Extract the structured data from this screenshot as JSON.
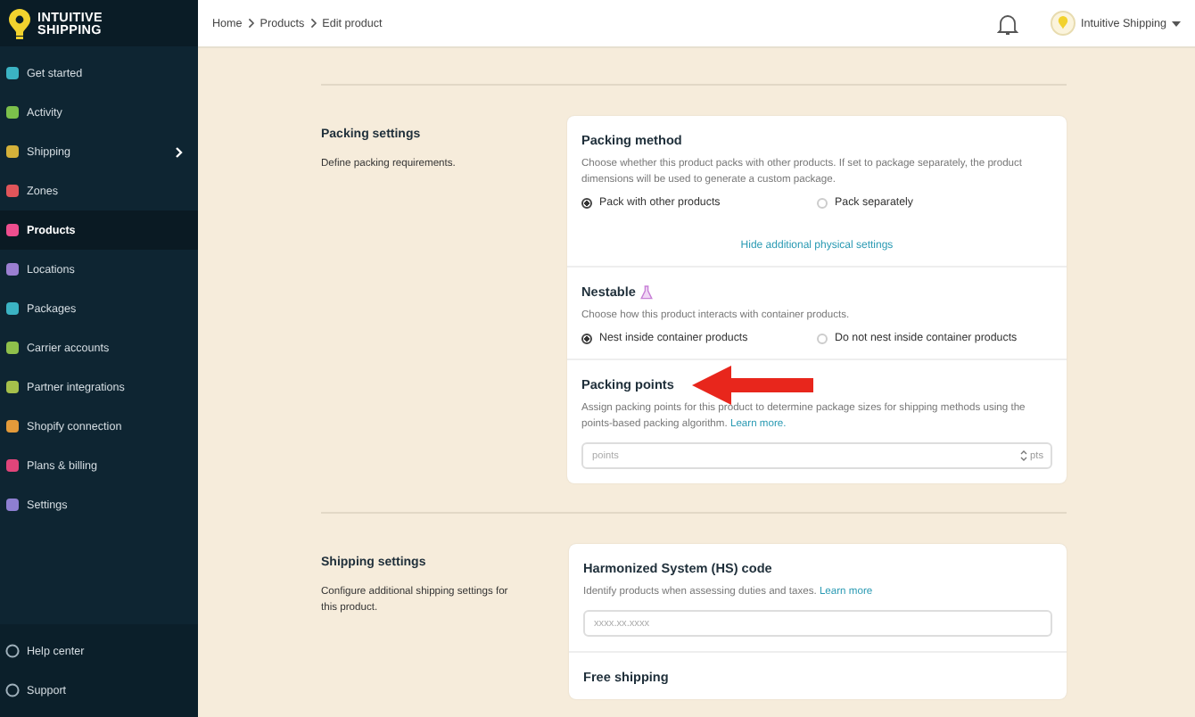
{
  "brand": {
    "line1": "INTUITIVE",
    "line2": "SHIPPING"
  },
  "sidebar": {
    "items": [
      {
        "label": "Get started",
        "selected": false,
        "expandable": false
      },
      {
        "label": "Activity",
        "selected": false,
        "expandable": false
      },
      {
        "label": "Shipping",
        "selected": false,
        "expandable": true
      },
      {
        "label": "Zones",
        "selected": false,
        "expandable": false
      },
      {
        "label": "Products",
        "selected": true,
        "expandable": false
      },
      {
        "label": "Locations",
        "selected": false,
        "expandable": false
      },
      {
        "label": "Packages",
        "selected": false,
        "expandable": false
      },
      {
        "label": "Carrier accounts",
        "selected": false,
        "expandable": false
      },
      {
        "label": "Partner integrations",
        "selected": false,
        "expandable": false
      },
      {
        "label": "Shopify connection",
        "selected": false,
        "expandable": false
      },
      {
        "label": "Plans & billing",
        "selected": false,
        "expandable": false
      },
      {
        "label": "Settings",
        "selected": false,
        "expandable": false
      }
    ],
    "footer": [
      "Help center",
      "Support"
    ]
  },
  "breadcrumb": [
    "Home",
    "Products",
    "Edit product"
  ],
  "account": {
    "name": "Intuitive Shipping"
  },
  "sections": [
    {
      "title": "Packing settings",
      "description": "Define packing requirements.",
      "cards": [
        {
          "kind": "radio",
          "title": "Packing method",
          "description": "Choose whether this product packs with other products. If set to package separately, the product dimensions will be used to generate a custom package.",
          "options": [
            {
              "label": "Pack with other products",
              "selected": true
            },
            {
              "label": "Pack separately",
              "selected": false
            }
          ],
          "link": "Hide additional physical settings"
        },
        {
          "kind": "radio",
          "title": "Nestable",
          "beta": true,
          "description": "Choose how this product interacts with container products.",
          "options": [
            {
              "label": "Nest inside container products",
              "selected": true
            },
            {
              "label": "Do not nest inside container products",
              "selected": false
            }
          ]
        },
        {
          "kind": "number",
          "title": "Packing points",
          "description": "Assign packing points for this product to determine package sizes for shipping methods using the points-based packing algorithm.",
          "learn": "Learn more.",
          "placeholder": "points",
          "unit": "pts",
          "arrow": true
        }
      ]
    },
    {
      "title": "Shipping settings",
      "description": "Configure additional shipping settings for this product.",
      "cards": [
        {
          "kind": "text",
          "title": "Harmonized System (HS) code",
          "description": "Identify products when assessing duties and taxes.",
          "learn": "Learn more",
          "placeholder": "xxxx.xx.xxxx"
        },
        {
          "kind": "heading",
          "title": "Free shipping"
        }
      ]
    }
  ]
}
